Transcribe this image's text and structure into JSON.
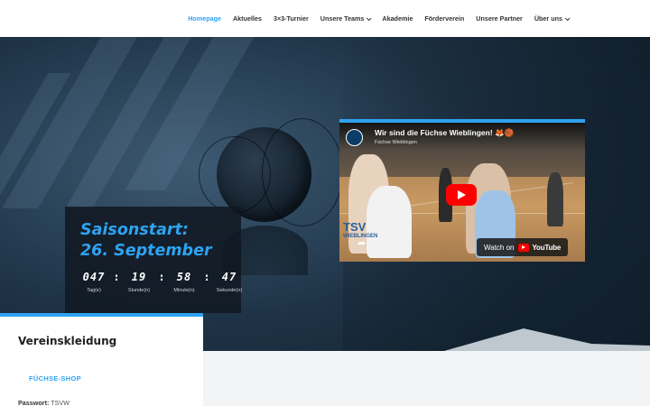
{
  "nav": {
    "items": [
      {
        "label": "Homepage",
        "active": true,
        "dropdown": false
      },
      {
        "label": "Aktuelles",
        "active": false,
        "dropdown": false
      },
      {
        "label": "3×3-Turnier",
        "active": false,
        "dropdown": false
      },
      {
        "label": "Unsere Teams",
        "active": false,
        "dropdown": true
      },
      {
        "label": "Akademie",
        "active": false,
        "dropdown": false
      },
      {
        "label": "Förderverein",
        "active": false,
        "dropdown": false
      },
      {
        "label": "Unsere Partner",
        "active": false,
        "dropdown": false
      },
      {
        "label": "Über uns",
        "active": false,
        "dropdown": true
      }
    ]
  },
  "countdown": {
    "title_line1": "Saisonstart:",
    "title_line2": "26. September",
    "days": "047",
    "hours": "19",
    "minutes": "58",
    "seconds": "47",
    "separator": ":",
    "days_label": "Tag(e)",
    "hours_label": "Stunde(n)",
    "minutes_label": "Minute(n)",
    "seconds_label": "Sekunde(n)"
  },
  "video": {
    "title": "Wir sind die Füchse Wieblingen! 🦊🏀",
    "channel": "Füchse Wieblingen",
    "watch_label": "Watch on",
    "platform": "YouTube",
    "logo_text_1": "TSV",
    "logo_text_2": "WIEBLINGEN"
  },
  "card": {
    "title": "Vereinskleidung",
    "shop_link": "FÜCHSE-SHOP",
    "password_label": "Passwort:",
    "password_value": "TSVW"
  },
  "colors": {
    "accent": "#2ea3f2",
    "youtube_red": "#ff0000"
  }
}
